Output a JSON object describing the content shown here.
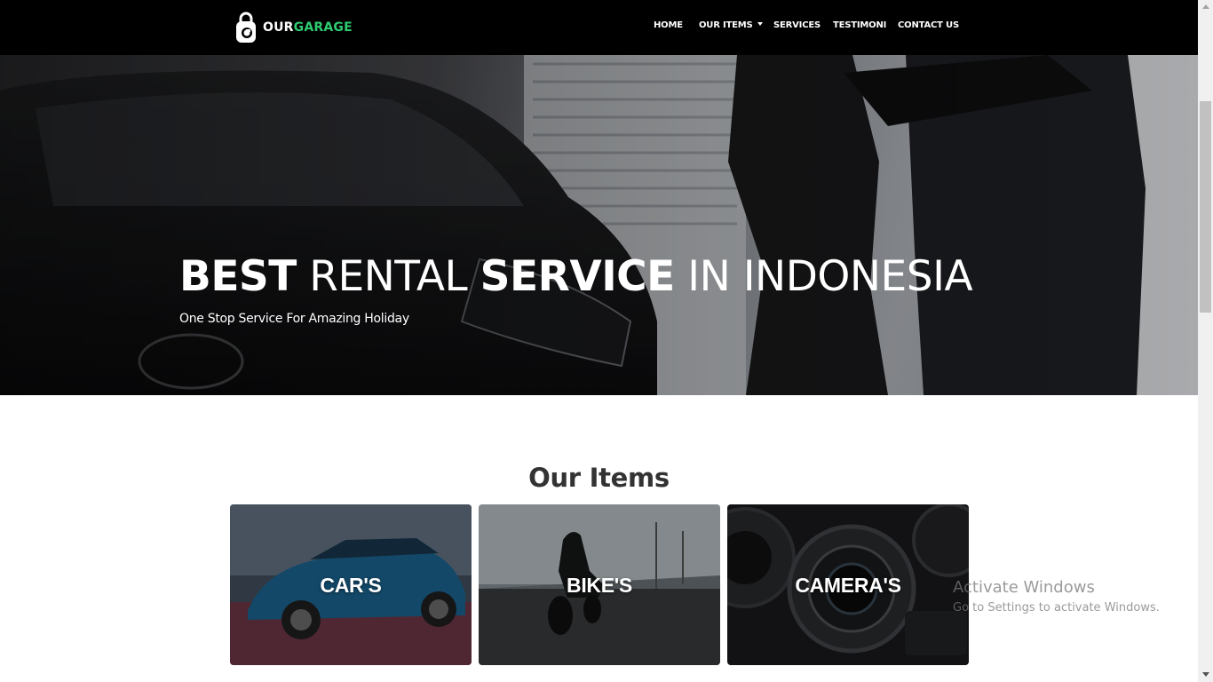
{
  "brand": {
    "part1": "OUR",
    "part2": "GARAGE",
    "accent": "#2ecc71",
    "logo_icon": "lock-garage-logo"
  },
  "nav": {
    "home": "HOME",
    "items": "OUR ITEMS",
    "services": "SERVICES",
    "testimoni": "TESTIMONI",
    "contact": "CONTACT US"
  },
  "hero": {
    "w1": "BEST",
    "w2": "RENTAL",
    "w3": "SERVICE",
    "w4": "IN INDONESIA",
    "subtitle": "One Stop Service For Amazing Holiday"
  },
  "items_section": {
    "title": "Our Items",
    "cards": [
      {
        "label": "CAR'S"
      },
      {
        "label": "BIKE'S"
      },
      {
        "label": "CAMERA'S"
      }
    ]
  },
  "watermark": {
    "title": "Activate Windows",
    "subtitle": "Go to Settings to activate Windows."
  }
}
